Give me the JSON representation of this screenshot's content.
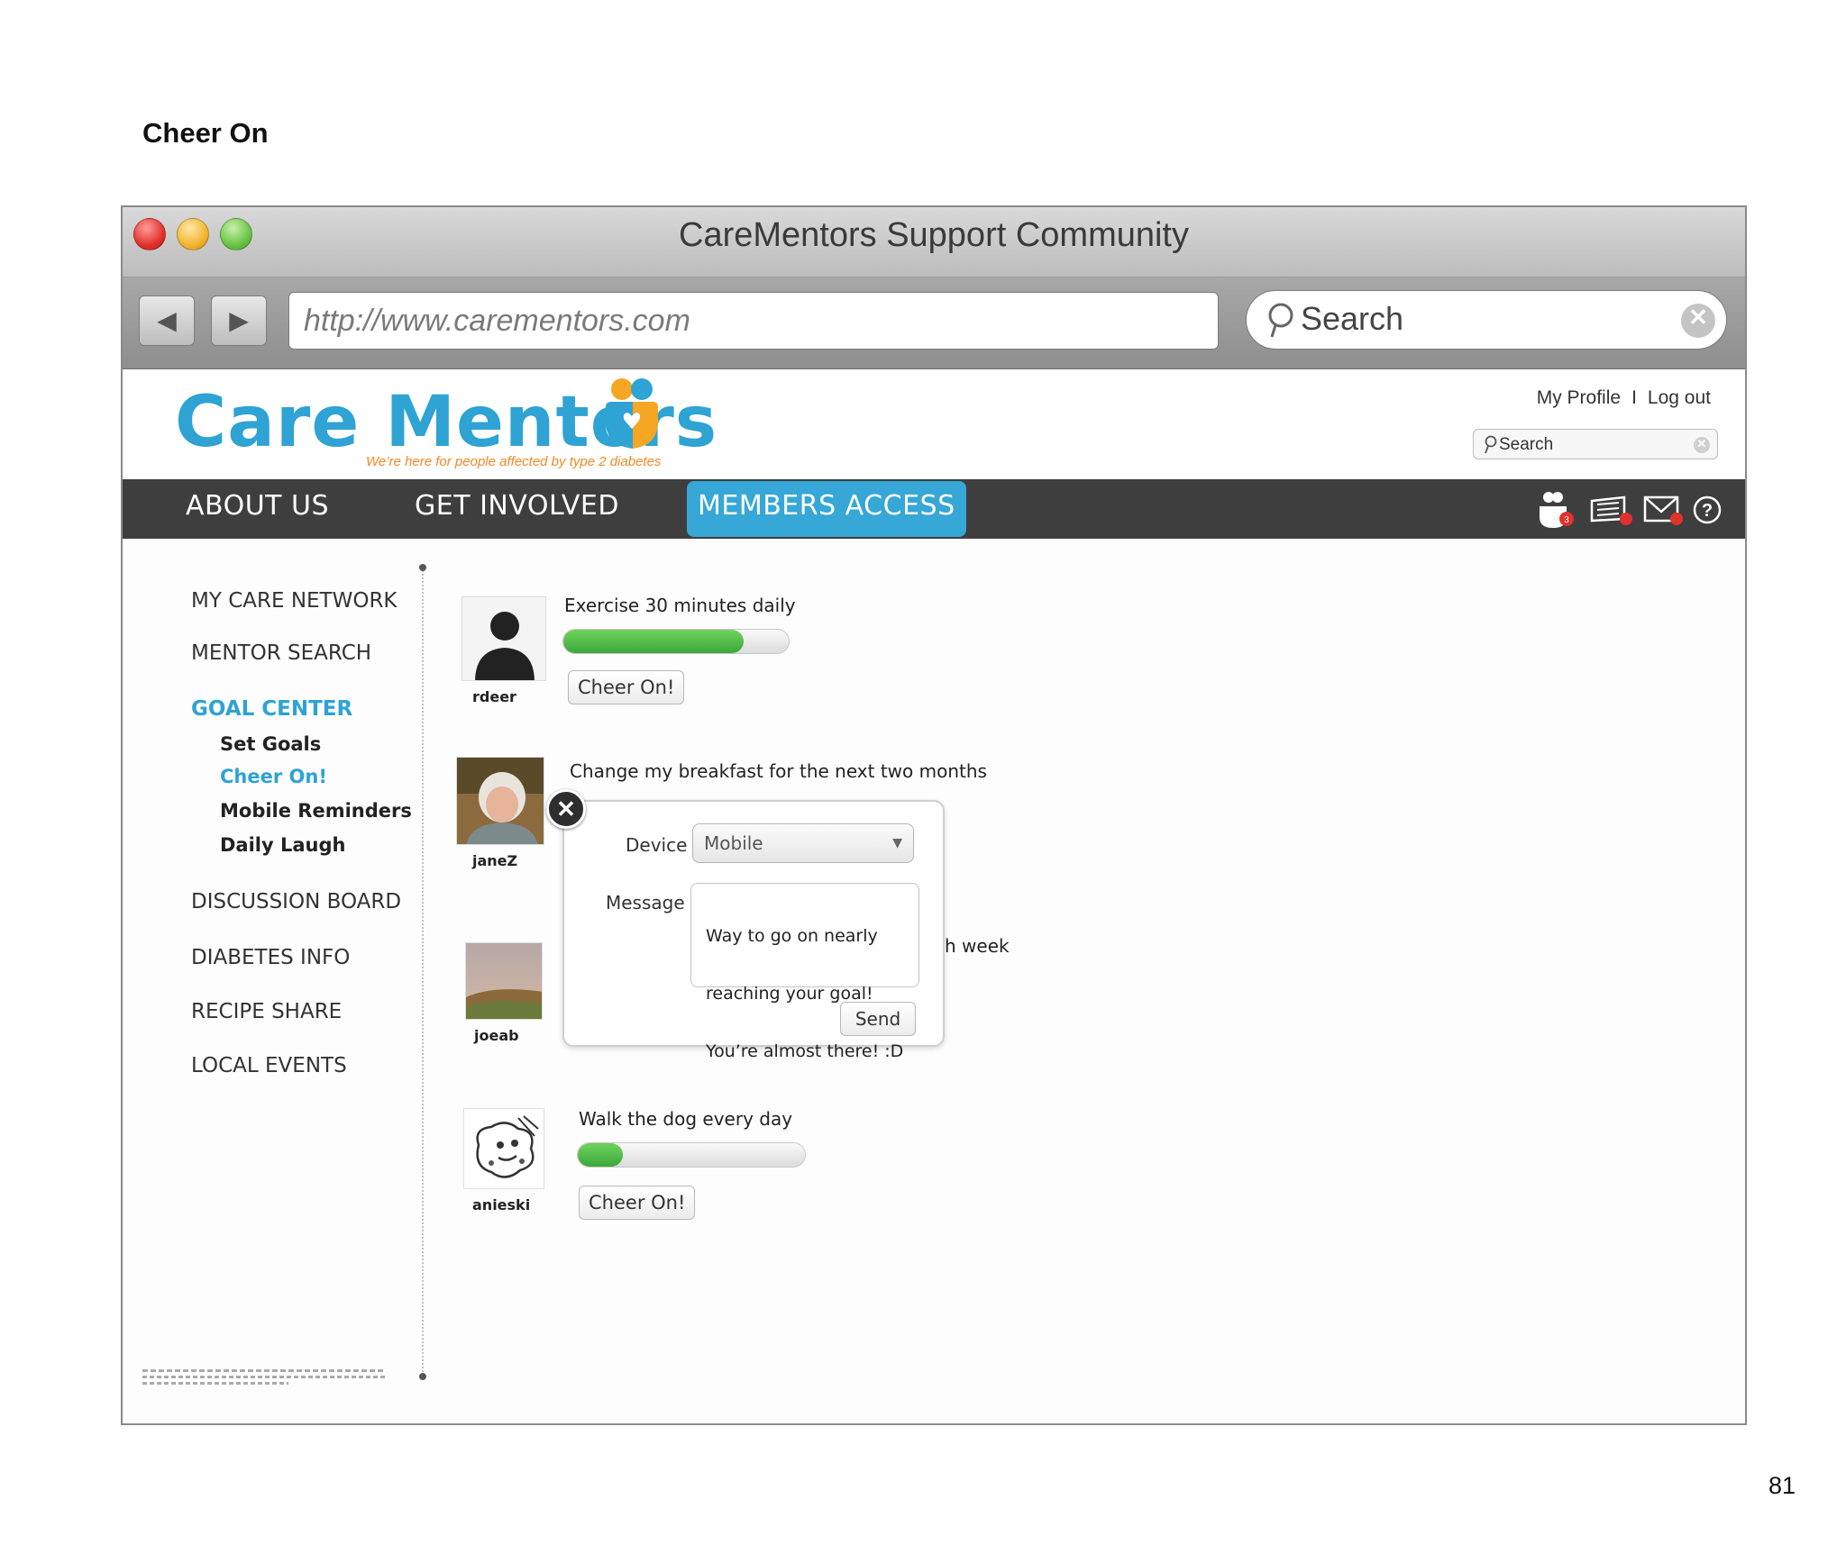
{
  "page": {
    "title": "Cheer On",
    "number": "81"
  },
  "browser": {
    "window_title": "CareMentors Support Community",
    "url": "http://www.carementors.com",
    "search_placeholder": "Search",
    "back_icon": "back-arrow-icon",
    "forward_icon": "forward-arrow-icon"
  },
  "site": {
    "logo_text": "Care Mentors",
    "tagline": "We’re here for people affected by type 2 diabetes",
    "my_profile": "My Profile",
    "separator": "I",
    "log_out": "Log out",
    "search_placeholder": "Search",
    "colors": {
      "brand_blue": "#2ea3d4",
      "tagline_orange": "#f08a24",
      "nav_bg": "#3e3e3e",
      "progress_green": "#3aa83a"
    }
  },
  "mainnav": {
    "about": "ABOUT US",
    "involved": "GET INVOLVED",
    "members": "MEMBERS ACCESS",
    "icons": [
      "mentors-notification-icon",
      "messages-list-icon",
      "mail-icon",
      "help-icon"
    ]
  },
  "sidebar": {
    "my_care_network": "MY CARE NETWORK",
    "mentor_search": "MENTOR SEARCH",
    "goal_center": "GOAL CENTER",
    "set_goals": "Set Goals",
    "cheer_on": "Cheer On!",
    "mobile_reminders": "Mobile Reminders",
    "daily_laugh": "Daily Laugh",
    "discussion_board": "DISCUSSION BOARD",
    "diabetes_info": "DIABETES INFO",
    "recipe_share": "RECIPE SHARE",
    "local_events": "LOCAL EVENTS"
  },
  "goals": [
    {
      "user": "rdeer",
      "goal": "Exercise 30 minutes daily",
      "progress": 0.8,
      "button": "Cheer On!"
    },
    {
      "user": "janeZ",
      "goal": "Change my breakfast for the next two months"
    },
    {
      "user": "joeab",
      "goal_partial": "h week"
    },
    {
      "user": "anieski",
      "goal": "Walk the dog every day",
      "progress": 0.2,
      "button": "Cheer On!"
    }
  ],
  "cheer_panel": {
    "device_label": "Device",
    "device_value": "Mobile",
    "message_label": "Message",
    "message_line1": "Way to go on nearly",
    "message_line2": "reaching your goal!",
    "message_line3": "You’re almost there! :D",
    "send": "Send"
  }
}
